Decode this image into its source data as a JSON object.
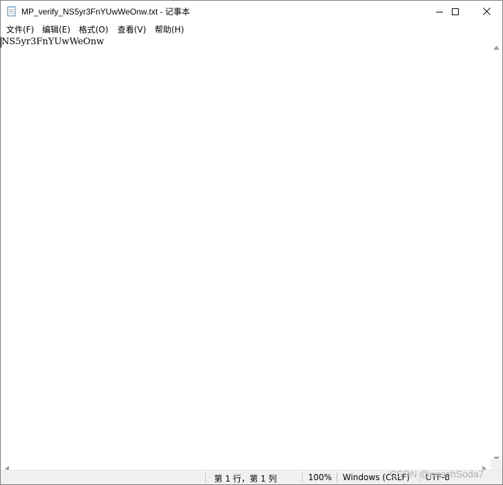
{
  "window": {
    "title": "MP_verify_NS5yr3FnYUwWeOnw.txt - 记事本",
    "minimize_label": "Minimize",
    "maximize_label": "Maximize",
    "close_label": "Close"
  },
  "menu": {
    "items": [
      {
        "label": "文件(F)"
      },
      {
        "label": "编辑(E)"
      },
      {
        "label": "格式(O)"
      },
      {
        "label": "查看(V)"
      },
      {
        "label": "帮助(H)"
      }
    ]
  },
  "editor": {
    "content": "NS5yr3FnYUwWeOnw"
  },
  "statusbar": {
    "position": "第 1 行，第 1 列",
    "zoom": "100%",
    "line_ending": "Windows (CRLF)",
    "encoding": "UTF-8"
  },
  "watermark": {
    "text": "CSDN @peachSoda7"
  },
  "colors": {
    "window_border": "#7f7f7f",
    "statusbar_bg": "#f0f0f0"
  },
  "icons": {
    "app": "notepad-icon",
    "minimize": "minimize-icon",
    "maximize": "maximize-icon",
    "close": "close-icon"
  }
}
